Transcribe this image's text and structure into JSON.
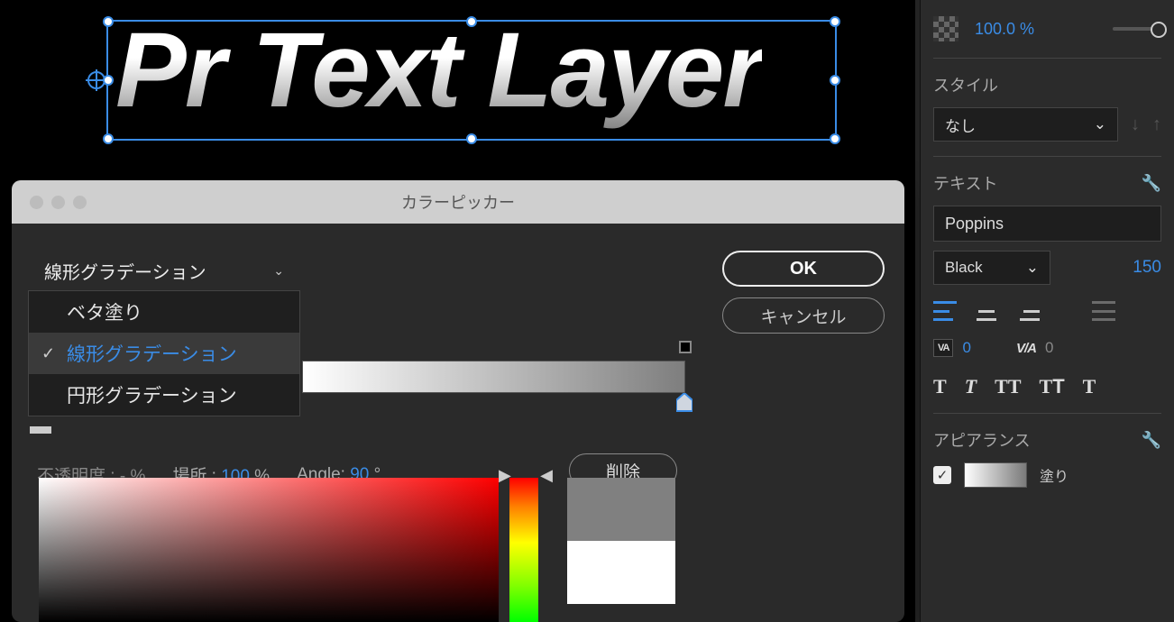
{
  "canvas": {
    "text": "Pr Text Layer"
  },
  "dialog": {
    "title": "カラーピッカー",
    "ok": "OK",
    "cancel": "キャンセル",
    "fillType": {
      "selected": "線形グラデーション",
      "options": [
        "ベタ塗り",
        "線形グラデーション",
        "円形グラデーション"
      ],
      "activeIndex": 1
    },
    "opacityLabel": "不透明度 :",
    "opacityValue": "- %",
    "locationLabel": "場所 :",
    "locationValue": "100",
    "locationUnit": "%",
    "angleLabel": "Angle:",
    "angleValue": "90",
    "angleUnit": "°",
    "delete": "削除"
  },
  "panel": {
    "opacity": "100.0 %",
    "styleTitle": "スタイル",
    "styleValue": "なし",
    "textTitle": "テキスト",
    "fontFamily": "Poppins",
    "fontWeight": "Black",
    "fontSize": "150",
    "trackingLabel": "VA",
    "trackingValue": "0",
    "kerningLabel": "V/A",
    "kerningValue": "0",
    "appearanceTitle": "アピアランス",
    "fillLabel": "塗り"
  }
}
